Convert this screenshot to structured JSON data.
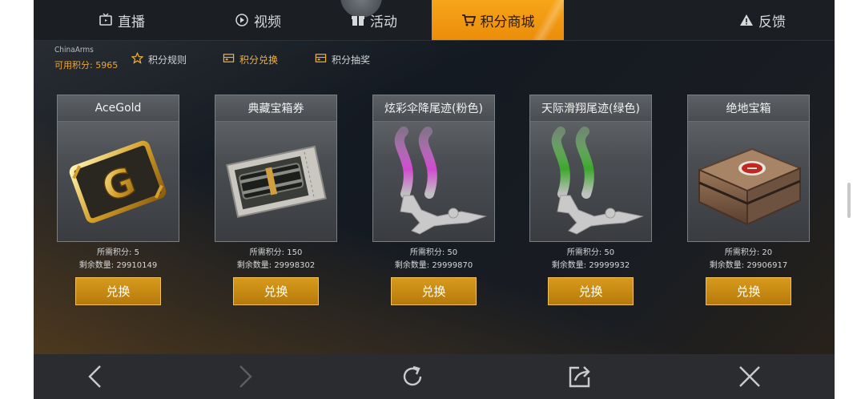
{
  "tabs": [
    {
      "label": "直播",
      "icon": "live-icon"
    },
    {
      "label": "视频",
      "icon": "play-icon"
    },
    {
      "label": "活动",
      "icon": "gift-icon"
    },
    {
      "label": "积分商城",
      "icon": "cart-icon",
      "active": true
    },
    {
      "label": "反馈",
      "icon": "warning-icon"
    }
  ],
  "user": {
    "name": "ChinaArms",
    "points": "可用积分: 5965"
  },
  "subnav": [
    {
      "label": "积分规则",
      "icon": "star-icon"
    },
    {
      "label": "积分兑换",
      "icon": "ticket-icon",
      "active": true
    },
    {
      "label": "积分抽奖",
      "icon": "ticket-icon"
    }
  ],
  "items": [
    {
      "title": "AceGold",
      "cost": "所需积分: 5",
      "stock": "剩余数量: 29910149",
      "button": "兑换",
      "art": "gold-card-icon"
    },
    {
      "title": "典藏宝箱券",
      "cost": "所需积分: 150",
      "stock": "剩余数量: 29998302",
      "button": "兑换",
      "art": "crate-coupon-icon"
    },
    {
      "title": "炫彩伞降尾迹(粉色)",
      "cost": "所需积分: 50",
      "stock": "剩余数量: 29999870",
      "button": "兑换",
      "art": "pink-trail-icon"
    },
    {
      "title": "天际滑翔尾迹(绿色)",
      "cost": "所需积分: 50",
      "stock": "剩余数量: 29999932",
      "button": "兑换",
      "art": "green-trail-icon"
    },
    {
      "title": "绝地宝箱",
      "cost": "所需积分: 20",
      "stock": "剩余数量: 29906917",
      "button": "兑换",
      "art": "crate-icon"
    }
  ],
  "colors": {
    "accent": "#f7a519",
    "button": "#c88a14",
    "points": "#f0a62a",
    "pink_trail": "#d86ad8",
    "green_trail": "#5bc24a"
  }
}
